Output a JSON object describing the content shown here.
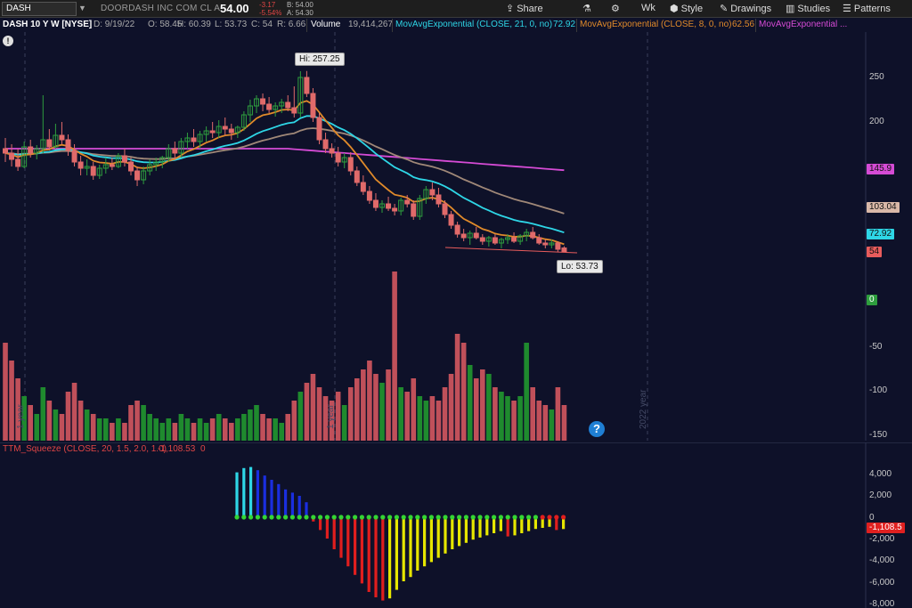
{
  "toolbar": {
    "symbol": "DASH",
    "company": "DOORDASH INC COM CL A",
    "last": "54.00",
    "change": "-3.17",
    "change_pct": "-5.54%",
    "bid": "B: 54.00",
    "ask": "A: 54.30",
    "share": "Share",
    "aggregation": "Wk",
    "style": "Style",
    "drawings": "Drawings",
    "studies": "Studies",
    "patterns": "Patterns"
  },
  "legend": {
    "title": "DASH 10 Y W [NYSE]",
    "date": "D: 9/19/22",
    "open": "O: 58.45",
    "high": "H: 60.39",
    "low": "L: 53.73",
    "close": "C: 54",
    "range": "R: 6.66",
    "volume_label": "Volume",
    "volume": "19,414,267",
    "ema21_label": "MovAvgExponential (CLOSE, 21, 0, no)",
    "ema21_value": "72.92",
    "ema8_label": "MovAvgExponential (CLOSE, 8, 0, no)",
    "ema8_value": "62.56",
    "ema3_label": "MovAvgExponential ..."
  },
  "callouts": {
    "high": "Hi: 257.25",
    "low": "Lo: 53.73"
  },
  "price_axis": {
    "ticks": [
      "250",
      "200",
      "0",
      "-50",
      "-100",
      "-150"
    ],
    "tags": [
      {
        "text": "145.9",
        "bg": "#d54bd5",
        "fg": "#111"
      },
      {
        "text": "103.04",
        "bg": "#d9b8a8",
        "fg": "#111"
      },
      {
        "text": "72.92",
        "bg": "#2ed6e6",
        "fg": "#111"
      },
      {
        "text": "54",
        "bg": "#e85c5c",
        "fg": "#111"
      }
    ],
    "zero_tag": "0"
  },
  "period_labels": {
    "year1": "1 year",
    "year2": "1 year",
    "year2022": "2022 year"
  },
  "osc": {
    "title": "TTM_Squeeze (CLOSE, 20, 1.5, 2.0, 1.0)",
    "value": "-1,108.53",
    "state": "0",
    "ticks": [
      "4,000",
      "2,000",
      "0",
      "-2,000",
      "-4,000",
      "-6,000",
      "-8,000"
    ],
    "value_tag": "-1,108.5"
  },
  "colors": {
    "background": "#0e1129",
    "up_candle": "#2e9e3e",
    "down_candle": "#e06a6a",
    "ema21": "#2ed6e6",
    "ema8": "#e08a2a",
    "ema3": "#d54bd5",
    "long_ma": "#a08878"
  },
  "chart_data": {
    "type": "candlestick",
    "title": "DASH 10 Y W [NYSE]",
    "price_range": [
      40,
      290
    ],
    "weeks": [
      {
        "o": 170,
        "h": 182,
        "l": 155,
        "c": 165,
        "v": 22
      },
      {
        "o": 165,
        "h": 175,
        "l": 150,
        "c": 158,
        "v": 18
      },
      {
        "o": 158,
        "h": 170,
        "l": 145,
        "c": 150,
        "v": 14
      },
      {
        "o": 150,
        "h": 178,
        "l": 148,
        "c": 172,
        "v": 10
      },
      {
        "o": 172,
        "h": 180,
        "l": 160,
        "c": 165,
        "v": 8
      },
      {
        "o": 165,
        "h": 174,
        "l": 158,
        "c": 170,
        "v": 6
      },
      {
        "o": 170,
        "h": 230,
        "l": 165,
        "c": 180,
        "v": 12
      },
      {
        "o": 180,
        "h": 192,
        "l": 168,
        "c": 172,
        "v": 9
      },
      {
        "o": 172,
        "h": 198,
        "l": 170,
        "c": 185,
        "v": 7
      },
      {
        "o": 185,
        "h": 200,
        "l": 175,
        "c": 180,
        "v": 6
      },
      {
        "o": 180,
        "h": 186,
        "l": 162,
        "c": 168,
        "v": 11
      },
      {
        "o": 168,
        "h": 175,
        "l": 150,
        "c": 155,
        "v": 13
      },
      {
        "o": 155,
        "h": 162,
        "l": 140,
        "c": 148,
        "v": 9
      },
      {
        "o": 148,
        "h": 158,
        "l": 140,
        "c": 150,
        "v": 7
      },
      {
        "o": 150,
        "h": 155,
        "l": 135,
        "c": 140,
        "v": 6
      },
      {
        "o": 140,
        "h": 152,
        "l": 136,
        "c": 148,
        "v": 5
      },
      {
        "o": 148,
        "h": 160,
        "l": 142,
        "c": 152,
        "v": 5
      },
      {
        "o": 152,
        "h": 160,
        "l": 146,
        "c": 150,
        "v": 4
      },
      {
        "o": 150,
        "h": 165,
        "l": 148,
        "c": 162,
        "v": 5
      },
      {
        "o": 162,
        "h": 170,
        "l": 150,
        "c": 155,
        "v": 4
      },
      {
        "o": 155,
        "h": 160,
        "l": 140,
        "c": 145,
        "v": 8
      },
      {
        "o": 145,
        "h": 150,
        "l": 128,
        "c": 135,
        "v": 9
      },
      {
        "o": 135,
        "h": 150,
        "l": 130,
        "c": 145,
        "v": 8
      },
      {
        "o": 145,
        "h": 158,
        "l": 140,
        "c": 152,
        "v": 6
      },
      {
        "o": 152,
        "h": 160,
        "l": 145,
        "c": 155,
        "v": 5
      },
      {
        "o": 155,
        "h": 162,
        "l": 148,
        "c": 160,
        "v": 4
      },
      {
        "o": 160,
        "h": 175,
        "l": 155,
        "c": 170,
        "v": 5
      },
      {
        "o": 170,
        "h": 178,
        "l": 158,
        "c": 165,
        "v": 4
      },
      {
        "o": 165,
        "h": 182,
        "l": 160,
        "c": 178,
        "v": 6
      },
      {
        "o": 178,
        "h": 188,
        "l": 170,
        "c": 182,
        "v": 5
      },
      {
        "o": 182,
        "h": 192,
        "l": 172,
        "c": 178,
        "v": 4
      },
      {
        "o": 178,
        "h": 190,
        "l": 170,
        "c": 186,
        "v": 5
      },
      {
        "o": 186,
        "h": 195,
        "l": 178,
        "c": 190,
        "v": 4
      },
      {
        "o": 190,
        "h": 200,
        "l": 182,
        "c": 188,
        "v": 5
      },
      {
        "o": 188,
        "h": 202,
        "l": 182,
        "c": 195,
        "v": 6
      },
      {
        "o": 195,
        "h": 205,
        "l": 185,
        "c": 192,
        "v": 5
      },
      {
        "o": 192,
        "h": 198,
        "l": 180,
        "c": 188,
        "v": 4
      },
      {
        "o": 188,
        "h": 196,
        "l": 182,
        "c": 194,
        "v": 5
      },
      {
        "o": 194,
        "h": 212,
        "l": 190,
        "c": 208,
        "v": 6
      },
      {
        "o": 208,
        "h": 225,
        "l": 200,
        "c": 218,
        "v": 7
      },
      {
        "o": 218,
        "h": 230,
        "l": 210,
        "c": 226,
        "v": 8
      },
      {
        "o": 226,
        "h": 232,
        "l": 212,
        "c": 220,
        "v": 6
      },
      {
        "o": 220,
        "h": 228,
        "l": 210,
        "c": 214,
        "v": 5
      },
      {
        "o": 214,
        "h": 222,
        "l": 206,
        "c": 218,
        "v": 5
      },
      {
        "o": 218,
        "h": 226,
        "l": 210,
        "c": 222,
        "v": 4
      },
      {
        "o": 222,
        "h": 230,
        "l": 212,
        "c": 216,
        "v": 6
      },
      {
        "o": 216,
        "h": 240,
        "l": 205,
        "c": 210,
        "v": 9
      },
      {
        "o": 210,
        "h": 257,
        "l": 205,
        "c": 250,
        "v": 11
      },
      {
        "o": 250,
        "h": 257.25,
        "l": 228,
        "c": 232,
        "v": 13
      },
      {
        "o": 232,
        "h": 238,
        "l": 200,
        "c": 205,
        "v": 15
      },
      {
        "o": 205,
        "h": 210,
        "l": 175,
        "c": 180,
        "v": 12
      },
      {
        "o": 180,
        "h": 188,
        "l": 165,
        "c": 170,
        "v": 10
      },
      {
        "o": 170,
        "h": 176,
        "l": 160,
        "c": 165,
        "v": 9
      },
      {
        "o": 165,
        "h": 172,
        "l": 150,
        "c": 155,
        "v": 11
      },
      {
        "o": 155,
        "h": 165,
        "l": 148,
        "c": 160,
        "v": 8
      },
      {
        "o": 160,
        "h": 166,
        "l": 140,
        "c": 145,
        "v": 12
      },
      {
        "o": 145,
        "h": 150,
        "l": 128,
        "c": 132,
        "v": 14
      },
      {
        "o": 132,
        "h": 140,
        "l": 118,
        "c": 122,
        "v": 16
      },
      {
        "o": 122,
        "h": 128,
        "l": 108,
        "c": 112,
        "v": 18
      },
      {
        "o": 112,
        "h": 120,
        "l": 100,
        "c": 104,
        "v": 15
      },
      {
        "o": 104,
        "h": 112,
        "l": 98,
        "c": 108,
        "v": 13
      },
      {
        "o": 108,
        "h": 116,
        "l": 100,
        "c": 103,
        "v": 16
      },
      {
        "o": 103,
        "h": 108,
        "l": 95,
        "c": 100,
        "v": 38
      },
      {
        "o": 100,
        "h": 115,
        "l": 95,
        "c": 112,
        "v": 12
      },
      {
        "o": 112,
        "h": 118,
        "l": 104,
        "c": 108,
        "v": 11
      },
      {
        "o": 108,
        "h": 112,
        "l": 90,
        "c": 94,
        "v": 14
      },
      {
        "o": 94,
        "h": 118,
        "l": 90,
        "c": 114,
        "v": 10
      },
      {
        "o": 114,
        "h": 128,
        "l": 108,
        "c": 124,
        "v": 9
      },
      {
        "o": 124,
        "h": 132,
        "l": 112,
        "c": 118,
        "v": 10
      },
      {
        "o": 118,
        "h": 126,
        "l": 104,
        "c": 108,
        "v": 9
      },
      {
        "o": 108,
        "h": 112,
        "l": 92,
        "c": 96,
        "v": 12
      },
      {
        "o": 96,
        "h": 100,
        "l": 80,
        "c": 84,
        "v": 15
      },
      {
        "o": 84,
        "h": 88,
        "l": 70,
        "c": 74,
        "v": 24
      },
      {
        "o": 74,
        "h": 80,
        "l": 66,
        "c": 70,
        "v": 22
      },
      {
        "o": 70,
        "h": 78,
        "l": 62,
        "c": 75,
        "v": 17
      },
      {
        "o": 75,
        "h": 82,
        "l": 68,
        "c": 70,
        "v": 14
      },
      {
        "o": 70,
        "h": 74,
        "l": 62,
        "c": 66,
        "v": 16
      },
      {
        "o": 66,
        "h": 72,
        "l": 60,
        "c": 70,
        "v": 15
      },
      {
        "o": 70,
        "h": 74,
        "l": 62,
        "c": 64,
        "v": 12
      },
      {
        "o": 64,
        "h": 70,
        "l": 58,
        "c": 68,
        "v": 11
      },
      {
        "o": 68,
        "h": 74,
        "l": 63,
        "c": 70,
        "v": 10
      },
      {
        "o": 70,
        "h": 76,
        "l": 64,
        "c": 66,
        "v": 9
      },
      {
        "o": 66,
        "h": 74,
        "l": 62,
        "c": 72,
        "v": 10
      },
      {
        "o": 72,
        "h": 80,
        "l": 66,
        "c": 76,
        "v": 22
      },
      {
        "o": 76,
        "h": 82,
        "l": 68,
        "c": 70,
        "v": 12
      },
      {
        "o": 70,
        "h": 74,
        "l": 62,
        "c": 64,
        "v": 9
      },
      {
        "o": 64,
        "h": 68,
        "l": 58,
        "c": 62,
        "v": 8
      },
      {
        "o": 62,
        "h": 68,
        "l": 58,
        "c": 64,
        "v": 7
      },
      {
        "o": 64,
        "h": 66,
        "l": 54,
        "c": 57,
        "v": 12
      },
      {
        "o": 58.45,
        "h": 60.39,
        "l": 53.73,
        "c": 54,
        "v": 8
      }
    ],
    "ttm_squeeze_hist": [
      4200,
      4600,
      4700,
      4400,
      3900,
      3500,
      3100,
      2600,
      2300,
      2000,
      1400,
      -400,
      -1200,
      -2000,
      -3000,
      -3800,
      -4600,
      -5400,
      -6200,
      -7000,
      -7500,
      -7800,
      -7600,
      -6800,
      -6000,
      -5600,
      -5000,
      -4600,
      -4200,
      -3800,
      -3400,
      -3000,
      -2700,
      -2400,
      -2100,
      -1900,
      -1700,
      -1500,
      -1300,
      -1800,
      -1700,
      -1500,
      -1300,
      -1100,
      -1000,
      -900,
      -1200,
      -1108.53
    ],
    "ema21": 72.92,
    "ema8": 62.56,
    "ema_long_1": 145.9,
    "ema_long_2": 103.04,
    "last_close": 54
  }
}
